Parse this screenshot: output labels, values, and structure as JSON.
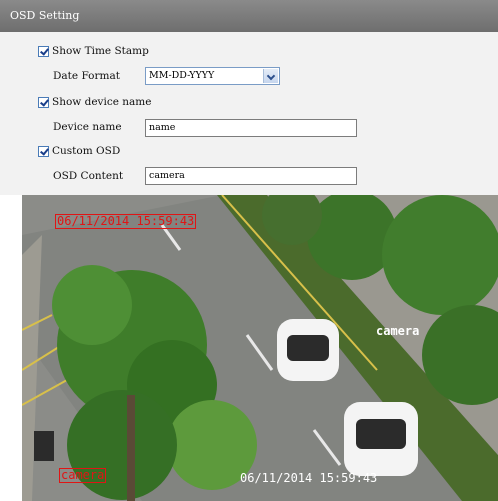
{
  "window": {
    "title": "OSD Setting"
  },
  "settings": {
    "show_time_stamp": {
      "label": "Show Time Stamp",
      "checked": true
    },
    "date_format": {
      "label": "Date Format",
      "value": "MM-DD-YYYY"
    },
    "show_device_name": {
      "label": "Show device name",
      "checked": true
    },
    "device_name": {
      "label": "Device name",
      "value": "name"
    },
    "custom_osd": {
      "label": "Custom OSD",
      "checked": true
    },
    "osd_content": {
      "label": "OSD Content",
      "value": "camera"
    }
  },
  "preview": {
    "timestamp_top": "06/11/2014 15:59:43",
    "custom_text": "camera",
    "device_label": "camera",
    "timestamp_bottom": "06/11/2014 15:59:43"
  },
  "colors": {
    "osd_red": "#e01515",
    "osd_white": "#ffffff",
    "title_bar": "#7a7a7a"
  }
}
